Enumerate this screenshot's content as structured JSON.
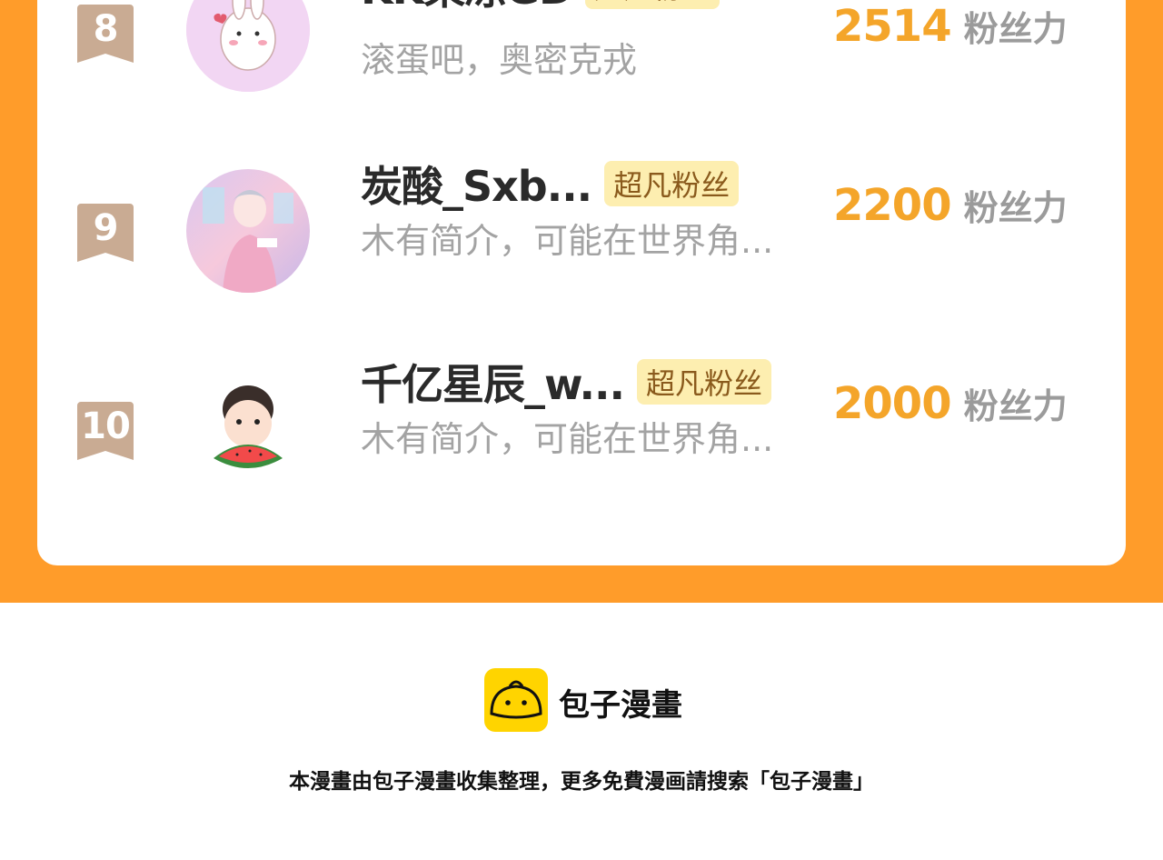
{
  "leaderboard": {
    "rows": [
      {
        "rank": "8",
        "name": "KK果冻GD",
        "tag": "超凡粉丝",
        "bio": "滚蛋吧，奥密克戎",
        "score": "2514",
        "unit": "粉丝力"
      },
      {
        "rank": "9",
        "name": "炭酸_Sxb...",
        "tag": "超凡粉丝",
        "bio": "木有简介，可能在世界角...",
        "score": "2200",
        "unit": "粉丝力"
      },
      {
        "rank": "10",
        "name": "千亿星辰_w...",
        "tag": "超凡粉丝",
        "bio": "木有简介，可能在世界角...",
        "score": "2000",
        "unit": "粉丝力"
      }
    ]
  },
  "footer": {
    "brand": "包子漫畫",
    "note": "本漫畫由包子漫畫收集整理，更多免費漫画請搜索「包子漫畫」"
  },
  "colors": {
    "page_bg": "#ff9c2a",
    "badge": "#c9ab93",
    "tag_bg": "#fdeeb0",
    "score": "#f4a52a",
    "logo_yellow": "#ffd400"
  },
  "icons": {
    "rank_badge": "ribbon-badge",
    "logo": "steamed-bun-icon"
  }
}
